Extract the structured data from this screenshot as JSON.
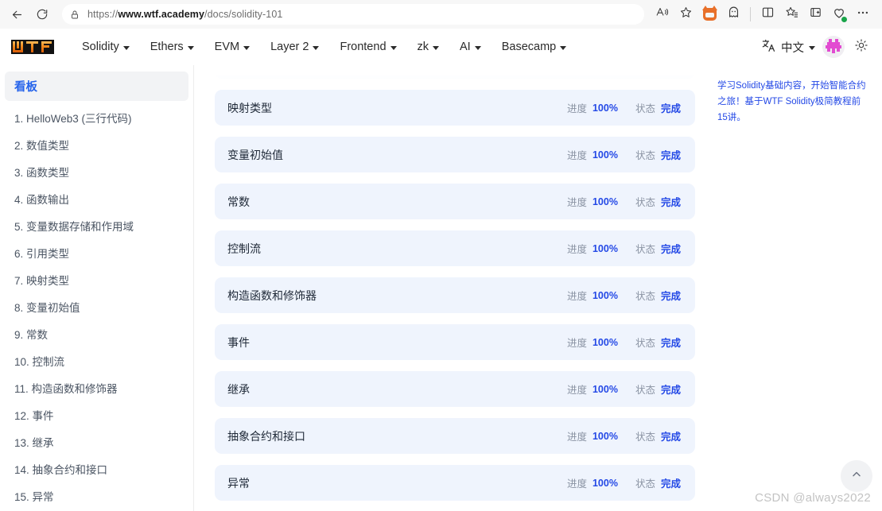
{
  "browser": {
    "back_icon": "back-arrow-icon",
    "reload_icon": "reload-icon",
    "lock_icon": "lock-icon",
    "url_prefix": "https://",
    "url_domain": "www.wtf.academy",
    "url_path": "/docs/solidity-101",
    "read_aloud_icon": "read-aloud-icon",
    "favorite_icon": "star-icon",
    "extensions": [
      {
        "name": "metamask-extension-icon"
      },
      {
        "name": "ghost-extension-icon"
      },
      {
        "name": "split-screen-icon"
      },
      {
        "name": "favorites-icon"
      },
      {
        "name": "collections-icon"
      },
      {
        "name": "browser-essentials-icon"
      }
    ],
    "more_icon": "more-options-icon"
  },
  "header": {
    "logo_text": "WTF",
    "nav": [
      {
        "label": "Solidity",
        "has_caret": true
      },
      {
        "label": "Ethers",
        "has_caret": true
      },
      {
        "label": "EVM",
        "has_caret": true
      },
      {
        "label": "Layer 2",
        "has_caret": true
      },
      {
        "label": "Frontend",
        "has_caret": true
      },
      {
        "label": "zk",
        "has_caret": true
      },
      {
        "label": "AI",
        "has_caret": true
      },
      {
        "label": "Basecamp",
        "has_caret": true
      }
    ],
    "translate_icon": "translate-icon",
    "language_label": "中文",
    "avatar_name": "user-avatar",
    "theme_icon": "sun-icon"
  },
  "sidebar": {
    "active_item": "看板",
    "items": [
      "1. HelloWeb3 (三行代码)",
      "2. 数值类型",
      "3. 函数类型",
      "4. 函数输出",
      "5. 变量数据存储和作用域",
      "6. 引用类型",
      "7. 映射类型",
      "8. 变量初始值",
      "9. 常数",
      "10. 控制流",
      "11. 构造函数和修饰器",
      "12. 事件",
      "13. 继承",
      "14. 抽象合约和接口",
      "15. 异常"
    ]
  },
  "main": {
    "progress_label": "进度",
    "status_label": "状态",
    "cards": [
      {
        "title": "",
        "progress": "",
        "status": "",
        "clipped": true
      },
      {
        "title": "映射类型",
        "progress": "100%",
        "status": "完成"
      },
      {
        "title": "变量初始值",
        "progress": "100%",
        "status": "完成"
      },
      {
        "title": "常数",
        "progress": "100%",
        "status": "完成"
      },
      {
        "title": "控制流",
        "progress": "100%",
        "status": "完成"
      },
      {
        "title": "构造函数和修饰器",
        "progress": "100%",
        "status": "完成"
      },
      {
        "title": "事件",
        "progress": "100%",
        "status": "完成"
      },
      {
        "title": "继承",
        "progress": "100%",
        "status": "完成"
      },
      {
        "title": "抽象合约和接口",
        "progress": "100%",
        "status": "完成"
      },
      {
        "title": "异常",
        "progress": "100%",
        "status": "完成"
      }
    ]
  },
  "right_rail": {
    "description": "学习Solidity基础内容，开始智能合约之旅！基于WTF Solidity极简教程前15讲。"
  },
  "overlays": {
    "watermark": "CSDN @always2022",
    "to_top_icon": "chevron-up-icon"
  },
  "colors": {
    "accent_blue": "#2449e6",
    "card_bg": "#eff4fd",
    "sidebar_active_text": "#2563eb",
    "logo_orange": "#ef7f1a"
  }
}
